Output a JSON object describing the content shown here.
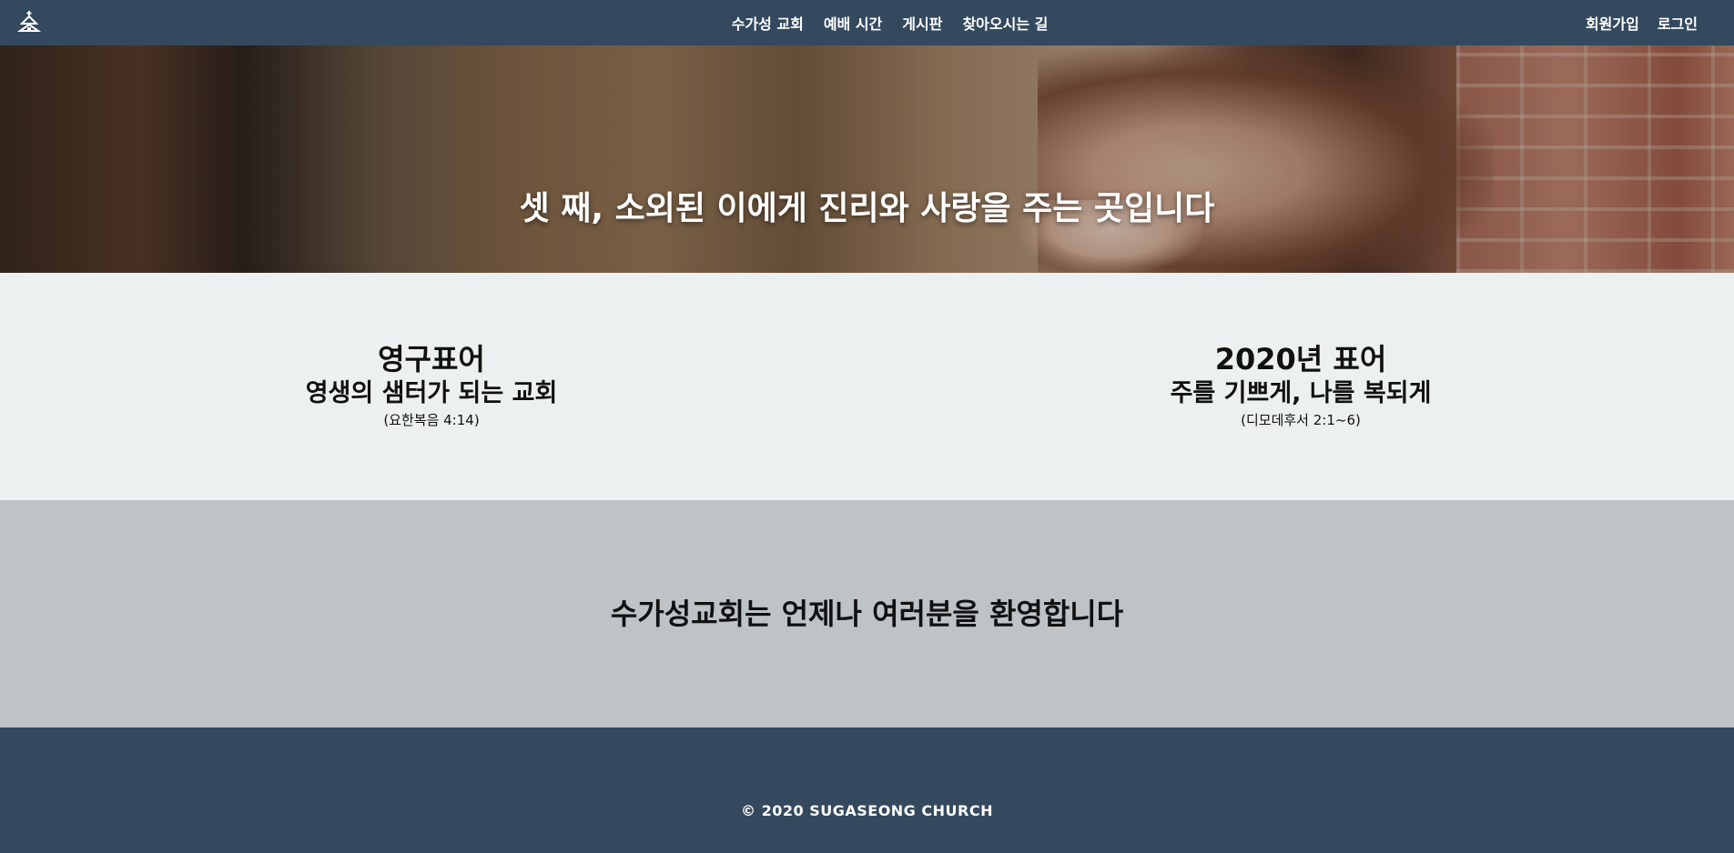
{
  "colors": {
    "navbar": "#34495e",
    "mottos_bg": "#ecf0f1",
    "welcome_bg": "#bdc3c7",
    "footer": "#34495e",
    "carousel_active_dot": "#1e7bf2"
  },
  "nav": {
    "logo_icon": "church-icon",
    "links": [
      "수가성 교회",
      "예배 시간",
      "게시판",
      "찾아오시는 길"
    ],
    "right_links": [
      "회원가입",
      "로그인"
    ]
  },
  "hero": {
    "caption": "셋 째, 소외된 이에게 진리와 사랑을 주는 곳입니다",
    "slide_count": 3,
    "active_slide": 3
  },
  "mottos": [
    {
      "title": "영구표어",
      "text": "영생의 샘터가 되는 교회",
      "ref": "(요한복음 4:14)"
    },
    {
      "title": "2020년 표어",
      "text": "주를 기쁘게, 나를 복되게",
      "ref": "(디모데후서 2:1~6)"
    }
  ],
  "welcome": {
    "text": "수가성교회는 언제나 여러분을 환영합니다"
  },
  "footer": {
    "copyright": "© 2020 SUGASEONG CHURCH"
  }
}
